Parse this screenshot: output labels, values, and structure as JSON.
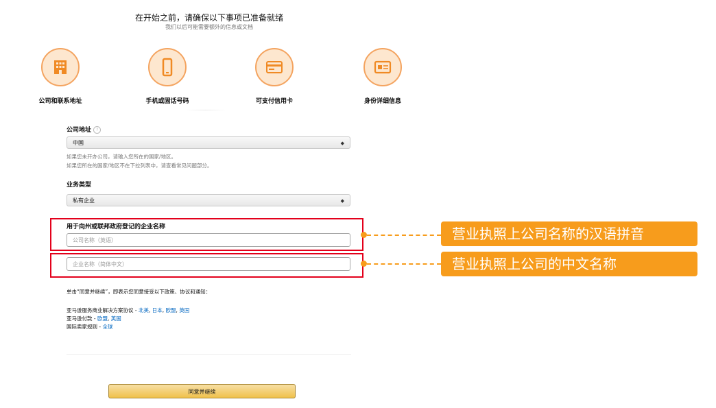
{
  "header": {
    "title": "在开始之前，请确保以下事项已准备就绪",
    "subtitle": "我们以后可能需要额外的信息或文档"
  },
  "requirements": [
    {
      "label": "公司和联系地址",
      "icon": "building-icon"
    },
    {
      "label": "手机或固话号码",
      "icon": "phone-icon"
    },
    {
      "label": "可支付信用卡",
      "icon": "credit-card-icon"
    },
    {
      "label": "身份详细信息",
      "icon": "id-card-icon"
    }
  ],
  "form": {
    "company_address": {
      "label": "公司地址",
      "value": "中国",
      "hint1": "如果您未开办公司，请输入您所在的国家/地区。",
      "hint2": "如果您所在的国家/地区不在下拉列表中，请查看常见问题部分。"
    },
    "business_type": {
      "label": "业务类型",
      "value": "私有企业"
    },
    "legal_name": {
      "label": "用于向州或联邦政府登记的企业名称",
      "placeholder_en": "公司名称（英语）",
      "placeholder_cn": "企业名称（简体中文）"
    },
    "agreement_intro": "单击“同意并继续”，即表示您同意接受以下政策、协议和通知：",
    "agreements": [
      {
        "text": "亚马逊服务商业解决方案协议 - ",
        "links": [
          "北美",
          "日本",
          "欧盟",
          "英国"
        ]
      },
      {
        "text": "亚马逊付款 - ",
        "links": [
          "欧盟",
          "英国"
        ]
      },
      {
        "text": "国际卖家规则 - ",
        "links": [
          "全球"
        ]
      }
    ],
    "submit_label": "同意并继续"
  },
  "callouts": [
    {
      "text": "营业执照上公司名称的汉语拼音"
    },
    {
      "text": "营业执照上公司的中文名称"
    }
  ],
  "colors": {
    "accent_orange": "#f79c1c",
    "highlight_red": "#e3001b",
    "link_blue": "#0066c0"
  }
}
